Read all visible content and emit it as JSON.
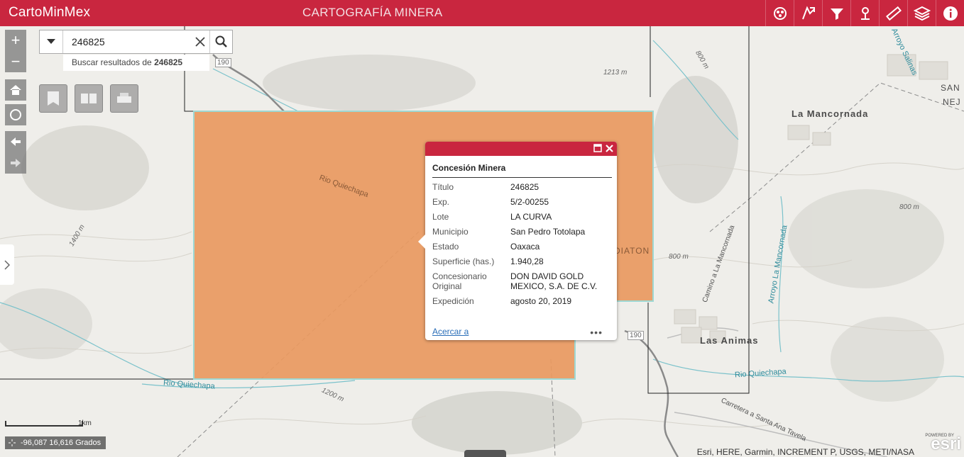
{
  "header": {
    "title": "CartoMinMex",
    "subtitle": "CARTOGRAFÍA MINERA",
    "color": "#c9263f",
    "tools": [
      "legend-icon",
      "concession-icon",
      "filter-icon",
      "location-icon",
      "measure-icon",
      "layers-icon",
      "info-icon"
    ]
  },
  "search": {
    "value": "246825",
    "suggestion_prefix": "Buscar resultados de ",
    "suggestion_term": "246825"
  },
  "map_labels": {
    "la_mancornada": "La Mancornada",
    "las_animas": "Las Animas",
    "rio_quiechapa_1": "Rio Quiechapa",
    "rio_quiechapa_2": "Rio Quiechapa",
    "rio_quiechapa_3": "Rio Quiechapa",
    "arroyo_la_mancornada": "Arroyo La Mancornada",
    "arroyo_salinas": "Arroyo Salinas",
    "camino": "Camino a La Mancornada",
    "carretera": "Carretera a Santa Ana Tavela",
    "elev_1213": "1213 m",
    "elev_800a": "800 m",
    "elev_800b": "800 m",
    "elev_800c": "800 m",
    "elev_1400": "1400 m",
    "elev_1200": "1200 m",
    "road_190a": "190",
    "road_190b": "190",
    "san": "SAN",
    "nej": "NEJ",
    "diaton": "DIATON"
  },
  "popup": {
    "title": "Concesión Minera",
    "fields": [
      {
        "key": "Título",
        "value": "246825"
      },
      {
        "key": "Exp.",
        "value": "5/2-00255"
      },
      {
        "key": "Lote",
        "value": "LA CURVA"
      },
      {
        "key": "Municipio",
        "value": "San Pedro Totolapa"
      },
      {
        "key": "Estado",
        "value": "Oaxaca"
      },
      {
        "key": "Superficie (has.)",
        "value": "1.940,28"
      },
      {
        "key": "Concesionario Original",
        "value": "DON DAVID GOLD MEXICO, S.A. DE C.V."
      },
      {
        "key": "Expedición",
        "value": "agosto 20, 2019"
      }
    ],
    "zoom_link": "Acercar a",
    "more": "•••"
  },
  "scale_label": "1km",
  "coordinates": "-96,087 16,616 Grados",
  "attribution": "Esri, HERE, Garmin, INCREMENT P, USGS, METI/NASA",
  "esri_logo": "esri",
  "esri_powered": "POWERED BY",
  "polygon_color": "#e9995f"
}
